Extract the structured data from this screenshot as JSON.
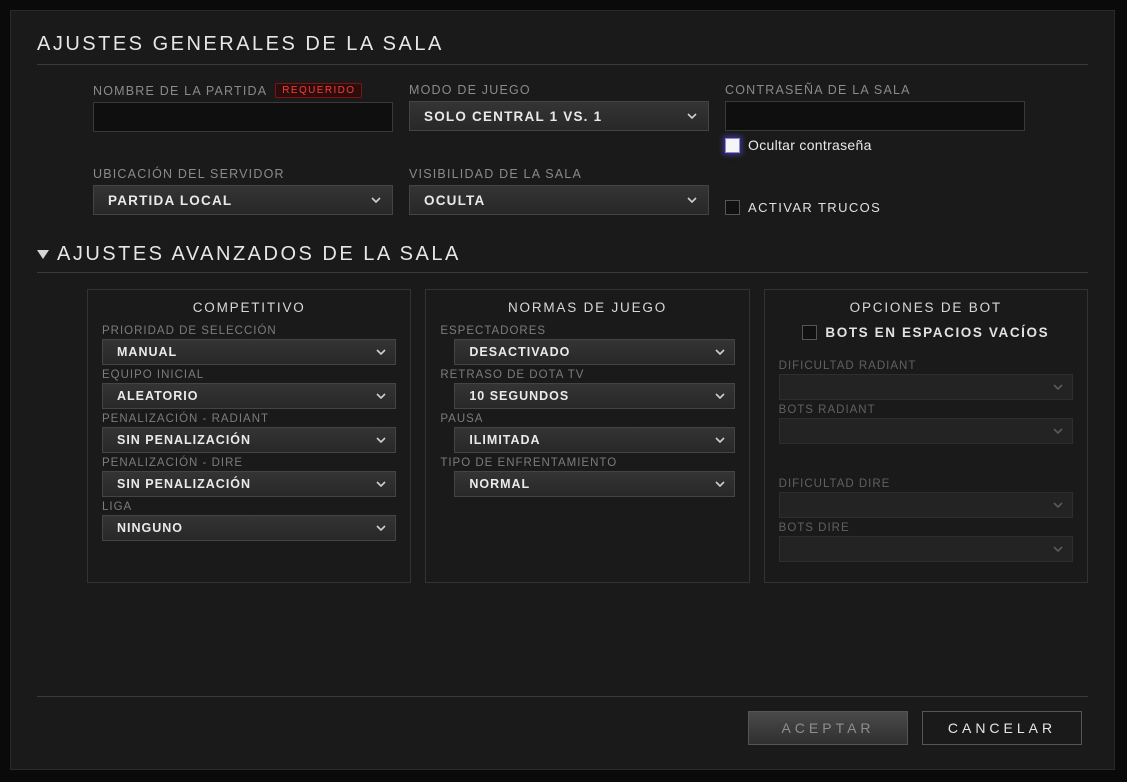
{
  "section_general_title": "AJUSTES GENERALES DE LA SALA",
  "fields": {
    "name_label": "NOMBRE DE LA PARTIDA",
    "name_required": "REQUERIDO",
    "name_value": "",
    "mode_label": "MODO DE JUEGO",
    "mode_value": "SOLO CENTRAL 1 VS. 1",
    "password_label": "CONTRASEÑA DE LA SALA",
    "password_value": "",
    "hide_password_label": "Ocultar contraseña",
    "server_label": "UBICACIÓN DEL SERVIDOR",
    "server_value": "PARTIDA LOCAL",
    "visibility_label": "VISIBILIDAD DE LA SALA",
    "visibility_value": "OCULTA",
    "cheats_label": "ACTIVAR TRUCOS"
  },
  "section_advanced_title": "AJUSTES AVANZADOS DE LA SALA",
  "competitive": {
    "title": "COMPETITIVO",
    "priority_label": "PRIORIDAD DE SELECCIÓN",
    "priority_value": "MANUAL",
    "team_label": "EQUIPO INICIAL",
    "team_value": "ALEATORIO",
    "pen_radiant_label": "PENALIZACIÓN - RADIANT",
    "pen_radiant_value": "SIN PENALIZACIÓN",
    "pen_dire_label": "PENALIZACIÓN - DIRE",
    "pen_dire_value": "SIN PENALIZACIÓN",
    "league_label": "LIGA",
    "league_value": "NINGUNO"
  },
  "rules": {
    "title": "NORMAS DE JUEGO",
    "spectators_label": "ESPECTADORES",
    "spectators_value": "DESACTIVADO",
    "delay_label": "RETRASO DE DOTA TV",
    "delay_value": "10 SEGUNDOS",
    "pause_label": "PAUSA",
    "pause_value": "ILIMITADA",
    "series_label": "TIPO DE ENFRENTAMIENTO",
    "series_value": "NORMAL"
  },
  "bots": {
    "title": "OPCIONES DE BOT",
    "fill_label": "BOTS EN ESPACIOS VACÍOS",
    "diff_radiant_label": "DIFICULTAD RADIANT",
    "diff_radiant_value": "",
    "bots_radiant_label": "BOTS RADIANT",
    "bots_radiant_value": "",
    "diff_dire_label": "DIFICULTAD DIRE",
    "diff_dire_value": "",
    "bots_dire_label": "BOTS DIRE",
    "bots_dire_value": ""
  },
  "buttons": {
    "accept": "ACEPTAR",
    "cancel": "CANCELAR"
  }
}
